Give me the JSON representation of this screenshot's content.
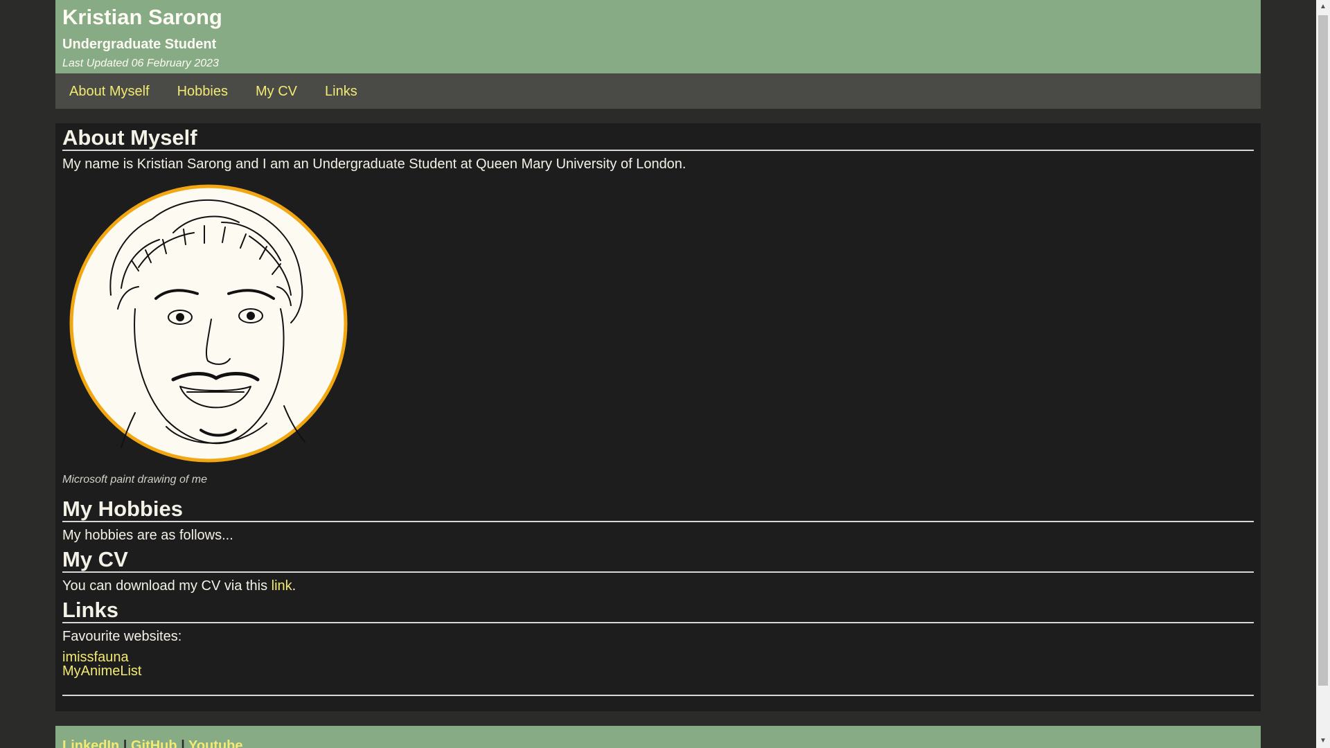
{
  "header": {
    "title": "Kristian Sarong",
    "subtitle": "Undergraduate Student",
    "updated": "Last Updated 06 February 2023"
  },
  "nav": {
    "items": [
      {
        "label": "About Myself"
      },
      {
        "label": "Hobbies"
      },
      {
        "label": "My CV"
      },
      {
        "label": "Links"
      }
    ]
  },
  "about": {
    "heading": "About Myself",
    "text": "My name is Kristian Sarong and I am an Undergraduate Student at Queen Mary University of London.",
    "caption": "Microsoft paint drawing of me"
  },
  "hobbies": {
    "heading": "My Hobbies",
    "text": "My hobbies are as follows..."
  },
  "cv": {
    "heading": "My CV",
    "text_before": "You can download my CV via this ",
    "link_label": "link",
    "text_after": "."
  },
  "links": {
    "heading": "Links",
    "intro": "Favourite websites:",
    "items": [
      {
        "label": "imissfauna"
      },
      {
        "label": "MyAnimeList"
      }
    ]
  },
  "footer": {
    "links": [
      {
        "label": "LinkedIn"
      },
      {
        "label": "GitHub"
      },
      {
        "label": "Youtube"
      }
    ],
    "separator": "|"
  },
  "colors": {
    "header_bg": "#86ab85",
    "nav_bg": "#4a4b47",
    "main_bg": "#1d1d1d",
    "page_bg": "#2b2b29",
    "link": "#f2ea72",
    "portrait_border": "#f2a712"
  }
}
